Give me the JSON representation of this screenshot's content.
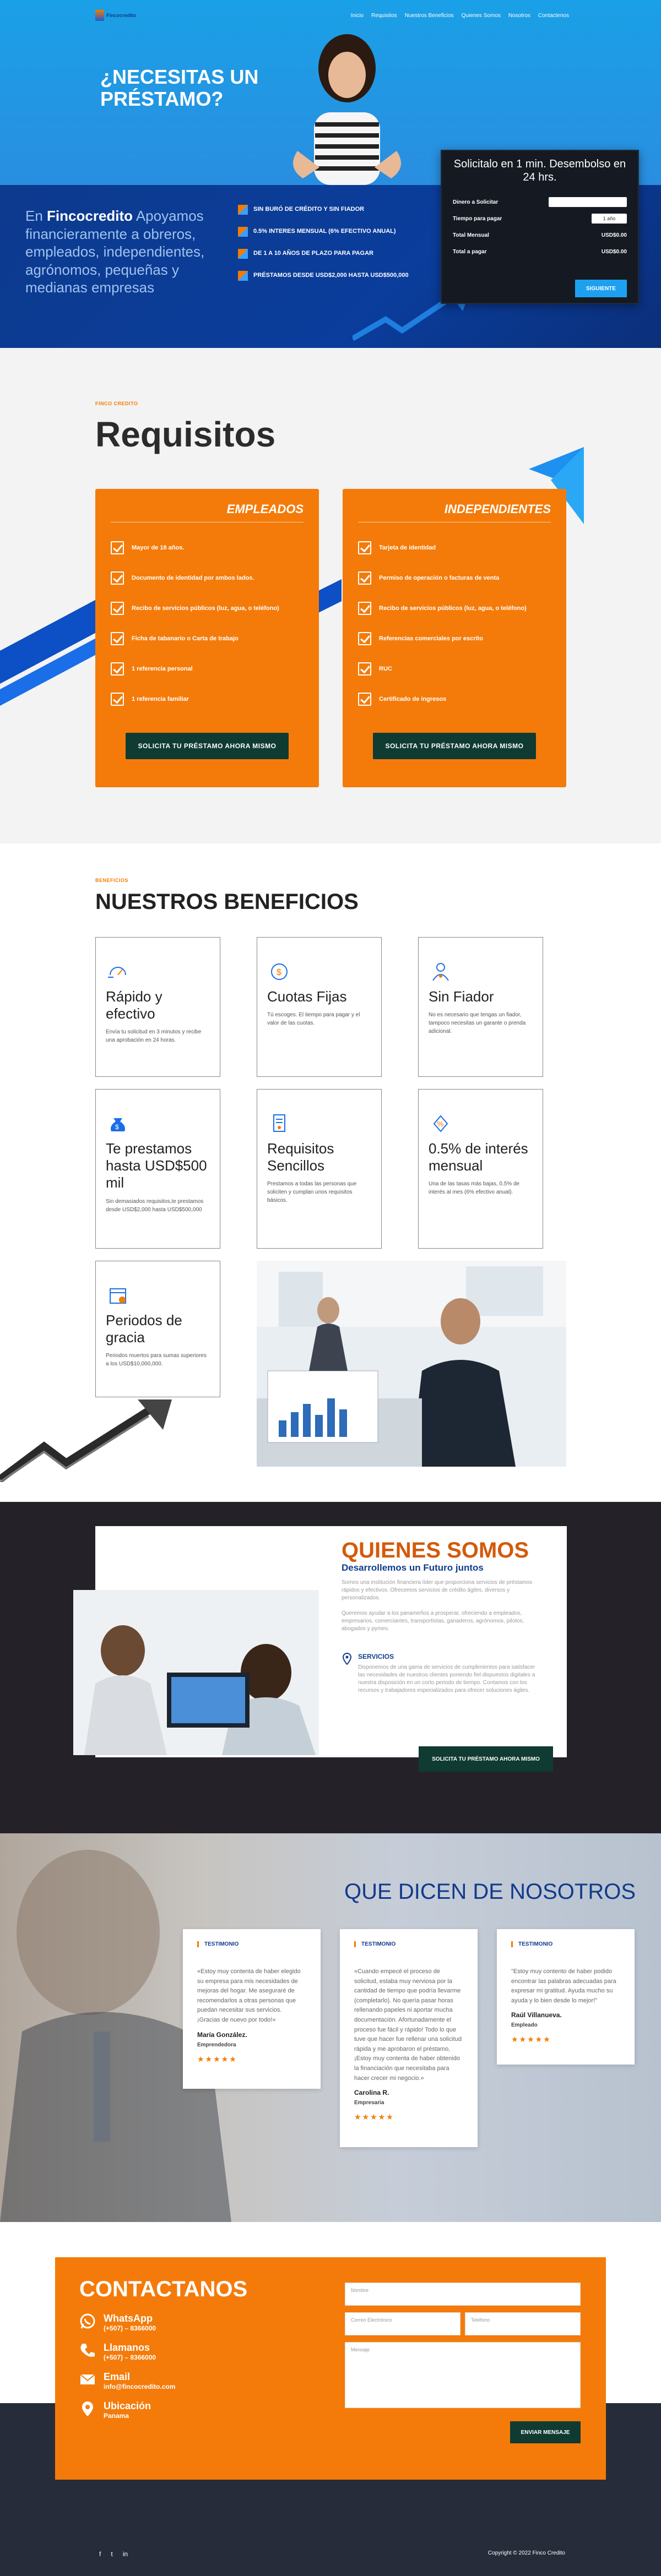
{
  "colors": {
    "orange": "#f47b0a",
    "navy": "#113b8c",
    "blue": "#1aa0e6",
    "dark_green": "#0f3b32",
    "dark": "#252128"
  },
  "nav": {
    "logo": "Fincocredito",
    "items": [
      "Inicio",
      "Requisitos",
      "Nuestros Beneficios",
      "Quienes Somos",
      "Nosotros",
      "Contactenos"
    ]
  },
  "hero": {
    "title": "¿NECESITAS UN PRÉSTAMO?",
    "lead_brand": "Fincocredito",
    "lead_prefix": "En ",
    "lead_text": " Apoyamos financieramente a obreros, empleados, independientes, agrónomos, pequeñas y medianas empresas",
    "features": [
      "SIN BURÓ DE CRÉDITO Y SIN FIADOR",
      "0.5% INTERES MENSUAL (6% EFECTIVO ANUAL)",
      "DE 1 A 10 AÑOS DE PLAZO PARA PAGAR",
      "PRÉSTAMOS DESDE USD$2,000 HASTA USD$500,000"
    ]
  },
  "calculator": {
    "title": "Solicitalo en 1 min. Desembolso en 24 hrs.",
    "amount_label": "Dinero a Solicitar",
    "term_label": "Tiempo para pagar",
    "term_value": "1 año",
    "monthly_label": "Total Mensual",
    "monthly_value": "USD$0.00",
    "total_label": "Total a pagar",
    "total_value": "USD$0.00",
    "button": "SIGUIENTE"
  },
  "requisitos": {
    "eyebrow": "FINCO CREDITO",
    "title": "Requisitos",
    "empleados": {
      "title": "EMPLEADOS",
      "items": [
        "Mayor de 18 años.",
        "Documento de identidad por ambos lados.",
        "Recibo de servicios públicos (luz, agua, o teléfono)",
        "Ficha de tabanario o Carta de trabajo",
        "1 referencia personal",
        "1 referencia familiar"
      ],
      "button": "SOLICITA TU PRÉSTAMO AHORA MISMO"
    },
    "independientes": {
      "title": "INDEPENDIENTES",
      "items": [
        "Tarjeta de identidad",
        "Permiso de operación o facturas de venta",
        "Recibo de servicios públicos (luz, agua, o teléfono)",
        "Referencias comerciales por escrito",
        "RUC",
        "Certificado de ingresos"
      ],
      "button": "SOLICITA TU PRÉSTAMO AHORA MISMO"
    }
  },
  "beneficios": {
    "eyebrow": "BENEFICIOS",
    "title": "NUESTROS BENEFICIOS",
    "cards": [
      {
        "title": "Rápido y efectivo",
        "text": "Envía tu solicitud en 3 minutos y recibe una aprobación en 24 horas.",
        "icon": "speed-icon"
      },
      {
        "title": "Cuotas Fijas",
        "text": "Tú escoges. El tiempo para pagar y el valor de las cuotas.",
        "icon": "coin-icon"
      },
      {
        "title": "Sin Fiador",
        "text": "No es necesario que tengas un fiador, tampoco necesitas un garante o prenda adicional.",
        "icon": "person-icon"
      },
      {
        "title": "Te prestamos hasta USD$500 mil",
        "text": "Sin demasiados requisitos,te prestamos desde USD$2,000 hasta USD$500,000",
        "icon": "money-bag-icon"
      },
      {
        "title": "Requisitos Sencillos",
        "text": "Prestamos a todas las personas que soliciten y cumplan unos requisitos básicos.",
        "icon": "document-icon"
      },
      {
        "title": "0.5% de interés mensual",
        "text": "Una de las tasas más bajas, 0.5% de interés al mes (6% efectivo anual).",
        "icon": "percent-icon"
      },
      {
        "title": "Periodos de gracia",
        "text": "Periodos muertos para sumas superiores a los USD$10,000,000.",
        "icon": "calendar-icon"
      }
    ]
  },
  "quienes": {
    "title": "QUIENES SOMOS",
    "subtitle": "Desarrollemos un Futuro juntos",
    "p1": "Somos una institución financiera líder que proporciona servicios de préstamos rápidos y efectivos. Ofrecemos servicios de crédito ágiles, diversos y personalizados.",
    "p2": "Queremos ayudar a los panameños a prosperar, ofreciendo a empleados, empresarios, comerciantes, transportistas, ganaderos, agrónomos, pilotos, abogados y pymes.",
    "svc_title": "SERVICIOS",
    "svc_text": "Disponemos de una gama de servicios de cumplimientos para satisfacer las necesidades de nuestros clientes poniendo fiel dispuestos digitales a nuestra disposición en un corto periodo de tiempo. Contamos con los recursos y trabajadores especializados para ofrecer soluciones ágiles.",
    "button": "SOLICITA TU PRÉSTAMO AHORA MISMO"
  },
  "testimonios": {
    "title": "QUE DICEN DE NOSOTROS",
    "items": [
      {
        "label": "TESTIMONIO",
        "text": "«Estoy muy contenta de haber elegido su empresa para mis necesidades de mejoras del hogar. Me aseguraré de recomendarlos a otras personas que puedan necesitar sus servicios. ¡Gracias de nuevo por todo!»",
        "name": "María González.",
        "role": "Emprendedora",
        "stars": "★★★★★"
      },
      {
        "label": "TESTIMONIO",
        "text": "«Cuando empecé el proceso de solicitud, estaba muy nerviosa por la cantidad de tiempo que podría llevarme (completarlo). No quería pasar horas rellenando papeles ni aportar mucha documentación. Afortunadamente el proceso fue fácil y rápido! Todo lo que tuve que hacer fue rellenar una solicitud rápida y me aprobaron el préstamo, ¡Estoy muy contenta de haber obtenido la financiación que necesitaba para hacer crecer mi negocio.»",
        "name": "Carolina R.",
        "role": "Empresaria",
        "stars": "★★★★★"
      },
      {
        "label": "TESTIMONIO",
        "text": "\"Estoy muy contento de haber podido encontrar las palabras adecuadas para expresar mi gratitud. Ayuda mucho su ayuda y lo bien desde lo mejor!\"",
        "name": "Raúl Villanueva.",
        "role": "Empleado",
        "stars": "★★★★★"
      }
    ]
  },
  "contacto": {
    "title": "CONTACTANOS",
    "items": [
      {
        "label": "WhatsApp",
        "value": "(+507) – 8366000",
        "icon": "whatsapp-icon"
      },
      {
        "label": "Llamanos",
        "value": "(+507) – 8366000",
        "icon": "phone-icon"
      },
      {
        "label": "Email",
        "value": "info@fincocredito.com",
        "icon": "email-icon"
      },
      {
        "label": "Ubicación",
        "value": "Panama",
        "icon": "location-icon"
      }
    ],
    "name_placeholder": "Nombre",
    "email_placeholder": "Correo Electrónico",
    "phone_placeholder": "Teléfono",
    "message_placeholder": "Mensaje",
    "button": "ENVIAR MENSAJE"
  },
  "footer": {
    "social": [
      "f",
      "t",
      "in"
    ],
    "copyright": "Copyright © 2022 Finco Credito"
  }
}
